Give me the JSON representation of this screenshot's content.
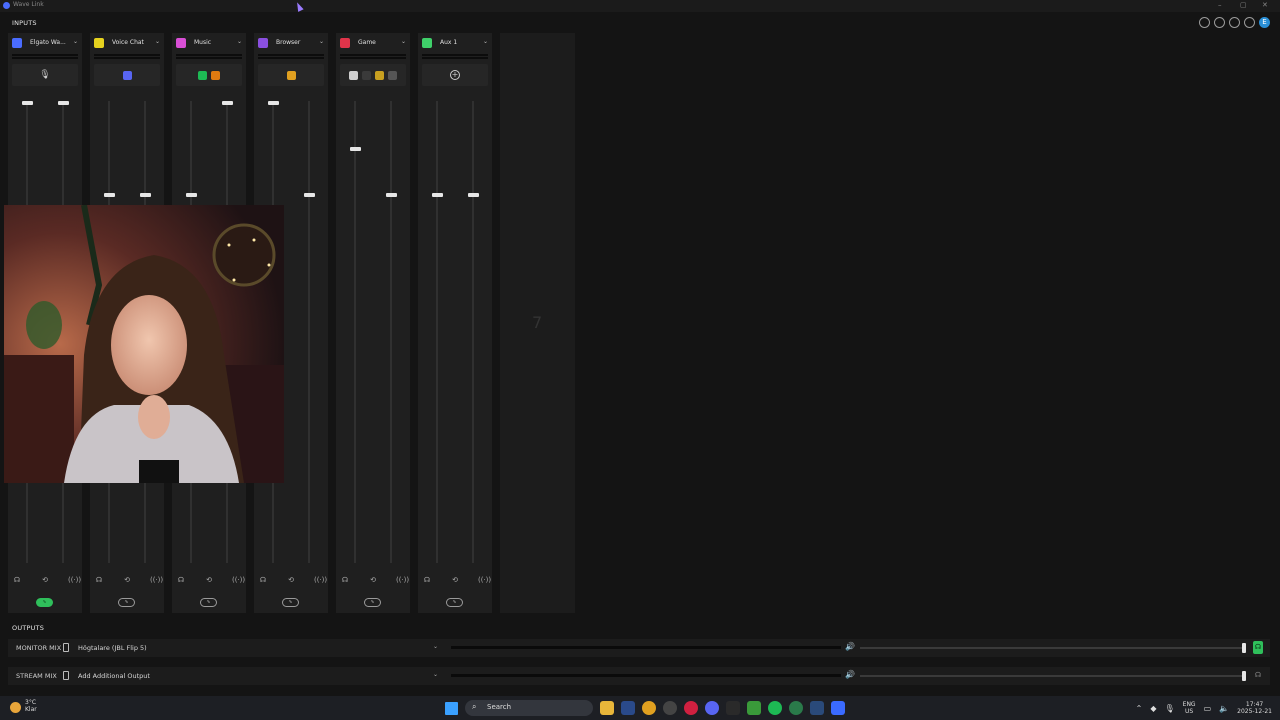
{
  "window": {
    "title": "Wave Link",
    "controls": [
      "–",
      "▢",
      "✕"
    ]
  },
  "inputs": {
    "section_label": "INPUTS",
    "channels": [
      {
        "name": "Elgato Wa...",
        "badge_color": "#4a6cff",
        "effect_on": true,
        "sliders": [
          0.0,
          0.0
        ],
        "apps": [
          "mic-icon"
        ]
      },
      {
        "name": "Voice Chat",
        "badge_color": "#e6d21f",
        "effect_on": false,
        "sliders": [
          0.2,
          0.2
        ],
        "apps": [
          "discord-icon"
        ]
      },
      {
        "name": "Music",
        "badge_color": "#d94fd6",
        "effect_on": false,
        "sliders": [
          0.2,
          0.0
        ],
        "apps": [
          "spotify-icon",
          "vlc-icon"
        ]
      },
      {
        "name": "Browser",
        "badge_color": "#8a4fe0",
        "effect_on": false,
        "sliders": [
          0.0,
          0.2
        ],
        "apps": [
          "chrome-icon"
        ]
      },
      {
        "name": "Game",
        "badge_color": "#e0344a",
        "effect_on": false,
        "sliders": [
          0.1,
          0.2
        ],
        "apps": [
          "game-app-icon",
          "steam-icon",
          "epic-icon",
          "more-apps-icon"
        ]
      },
      {
        "name": "Aux 1",
        "badge_color": "#3fd06a",
        "effect_on": false,
        "sliders": [
          0.2,
          0.2
        ],
        "apps": [
          "add-app-icon"
        ]
      }
    ],
    "empty_slot_number": "7"
  },
  "outputs": {
    "section_label": "OUTPUTS",
    "monitor_mix": {
      "label": "MONITOR MIX",
      "device": "Högtalare (JBL Flip 5)",
      "volume": 1.0,
      "listening": true
    },
    "stream_mix": {
      "label": "STREAM MIX",
      "device": "Add Additional Output",
      "volume": 1.0,
      "listening": false
    }
  },
  "taskbar": {
    "temperature": "3°C",
    "weather": "Klar",
    "search_placeholder": "Search",
    "language": "ENG",
    "region": "US",
    "time": "17:47",
    "date": "2025-12-21"
  },
  "colors": {
    "accent_green": "#2fbf5b",
    "background": "#141414",
    "panel": "#1f1f1f"
  }
}
